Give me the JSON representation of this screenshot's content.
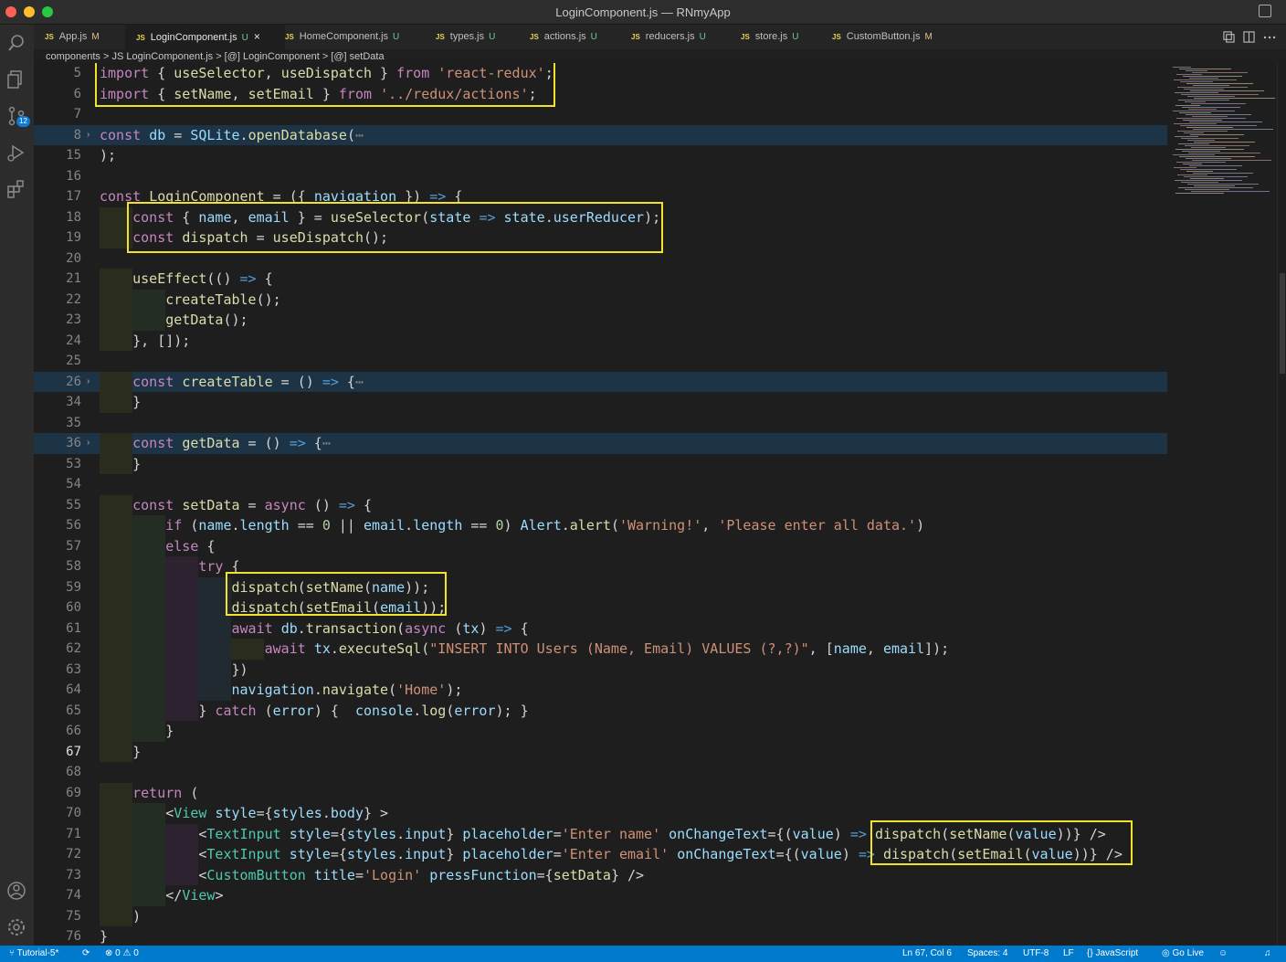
{
  "window": {
    "title": "LoginComponent.js — RNmyApp"
  },
  "activity_bar": {
    "source_control_badge": "12"
  },
  "tabs": [
    {
      "icon": "JS",
      "label": "App.js",
      "status": "M"
    },
    {
      "icon": "JS",
      "label": "LoginComponent.js",
      "status": "U",
      "close": "×"
    },
    {
      "icon": "JS",
      "label": "HomeComponent.js",
      "status": "U"
    },
    {
      "icon": "JS",
      "label": "types.js",
      "status": "U"
    },
    {
      "icon": "JS",
      "label": "actions.js",
      "status": "U"
    },
    {
      "icon": "JS",
      "label": "reducers.js",
      "status": "U"
    },
    {
      "icon": "JS",
      "label": "store.js",
      "status": "U"
    },
    {
      "icon": "JS",
      "label": "CustomButton.js",
      "status": "M"
    }
  ],
  "breadcrumb": "components > JS LoginComponent.js > [@] LoginComponent > [@] setData",
  "editor": {
    "lines": [
      {
        "n": "5",
        "text": "import { useSelector, useDispatch } from 'react-redux';"
      },
      {
        "n": "6",
        "text": "import { setName, setEmail } from '../redux/actions';"
      },
      {
        "n": "7",
        "text": ""
      },
      {
        "n": "8",
        "text": "const db = SQLite.openDatabase(⋯"
      },
      {
        "n": "15",
        "text": ");"
      },
      {
        "n": "16",
        "text": ""
      },
      {
        "n": "17",
        "text": "const LoginComponent = ({ navigation }) => {"
      },
      {
        "n": "18",
        "text": "    const { name, email } = useSelector(state => state.userReducer);"
      },
      {
        "n": "19",
        "text": "    const dispatch = useDispatch();"
      },
      {
        "n": "20",
        "text": ""
      },
      {
        "n": "21",
        "text": "    useEffect(() => {"
      },
      {
        "n": "22",
        "text": "        createTable();"
      },
      {
        "n": "23",
        "text": "        getData();"
      },
      {
        "n": "24",
        "text": "    }, []);"
      },
      {
        "n": "25",
        "text": ""
      },
      {
        "n": "26",
        "text": "    const createTable = () => {⋯"
      },
      {
        "n": "34",
        "text": "    }"
      },
      {
        "n": "35",
        "text": ""
      },
      {
        "n": "36",
        "text": "    const getData = () => {⋯"
      },
      {
        "n": "53",
        "text": "    }"
      },
      {
        "n": "54",
        "text": ""
      },
      {
        "n": "55",
        "text": "    const setData = async () => {"
      },
      {
        "n": "56",
        "text": "        if (name.length == 0 || email.length == 0) Alert.alert('Warning!', 'Please enter all data.')"
      },
      {
        "n": "57",
        "text": "        else {"
      },
      {
        "n": "58",
        "text": "            try {"
      },
      {
        "n": "59",
        "text": "                dispatch(setName(name));"
      },
      {
        "n": "60",
        "text": "                dispatch(setEmail(email));"
      },
      {
        "n": "61",
        "text": "                await db.transaction(async (tx) => {"
      },
      {
        "n": "62",
        "text": "                    await tx.executeSql(\"INSERT INTO Users (Name, Email) VALUES (?,?)\", [name, email]);"
      },
      {
        "n": "63",
        "text": "                })"
      },
      {
        "n": "64",
        "text": "                navigation.navigate('Home');"
      },
      {
        "n": "65",
        "text": "            } catch (error) {  console.log(error); }"
      },
      {
        "n": "66",
        "text": "        }"
      },
      {
        "n": "67",
        "text": "    }"
      },
      {
        "n": "68",
        "text": ""
      },
      {
        "n": "69",
        "text": "    return ("
      },
      {
        "n": "70",
        "text": "        <View style={styles.body} >"
      },
      {
        "n": "71",
        "text": "            <TextInput style={styles.input} placeholder='Enter name' onChangeText={(value) => dispatch(setName(value))} />"
      },
      {
        "n": "72",
        "text": "            <TextInput style={styles.input} placeholder='Enter email' onChangeText={(value) => dispatch(setEmail(value))} />"
      },
      {
        "n": "73",
        "text": "            <CustomButton title='Login' pressFunction={setData} />"
      },
      {
        "n": "74",
        "text": "        </View>"
      },
      {
        "n": "75",
        "text": "    )"
      },
      {
        "n": "76",
        "text": "}"
      }
    ]
  },
  "status_bar": {
    "branch": "Tutorial-5*",
    "errors": "0",
    "warnings": "0",
    "position": "Ln 67, Col 6",
    "spaces": "Spaces: 4",
    "encoding": "UTF-8",
    "eol": "LF",
    "language": "JavaScript",
    "go_live": "Go Live"
  }
}
